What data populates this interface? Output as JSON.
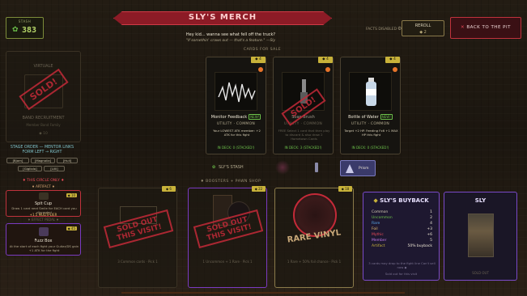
{
  "stash": {
    "label": "STASH",
    "icon": "cannabis-leaf-icon",
    "value": "383"
  },
  "header": {
    "title": "SLY'S MERCH",
    "line1": "Hey kid... wanna see what fell off the truck?",
    "line2": "\"If somethin' craws out — that's a feature.\" —Sly"
  },
  "facts": {
    "label": "FACTS DISABLED",
    "icon": "gear-icon"
  },
  "reroll": {
    "label": "REROLL",
    "cost": "◆ 2"
  },
  "back_button": {
    "label": "BACK TO THE PIT",
    "icon": "close-icon"
  },
  "left_card": {
    "title": "VIRTUALE",
    "name": "BAND RECRUITMENT",
    "sub": "Member Band Family",
    "num": "◆ 10",
    "stamp": "SOLD!"
  },
  "stage_order": {
    "line1": "STAGE ORDER — MENTOR LINKS",
    "line2": "FORM LEFT → RIGHT",
    "slots": [
      "[Bjorn]",
      "[Magnolia]",
      "[Hull]",
      "[Gigliolo]",
      "[Lilli]"
    ]
  },
  "circle": {
    "heading": "♦ THIS CIRCLE ONLY ♦",
    "subheading": "♦ ARTIFACT ♦",
    "cards": [
      {
        "name": "Spit Cup",
        "price": "◆ 10",
        "desc": "Draw 1 card next Smile for EACH card you discarded",
        "mult": "+1.5 MULTIPLIER"
      },
      {
        "name": "Fuzz Box",
        "price": "◆ 45",
        "desc": "At the start of each fight your Guitar/DS gain +1 ATK for the fight",
        "mult": ""
      }
    ],
    "effect_heading": "♦ EFFECT PEDAL ♦"
  },
  "cards_for_sale": {
    "heading": "CARDS FOR SALE",
    "cards": [
      {
        "name": "Monitor Feedback",
        "new": "NEW!",
        "type": "UTILITY · COMMON",
        "desc": "Your LOWEST ATK member: +2 ATK for this fight",
        "deck": "IN DECK: 0 (STACKED!)",
        "price": "◆ 4",
        "sold": false
      },
      {
        "name": "Soap Brush",
        "new": "",
        "type": "UTILITY · COMMON",
        "desc": "FREE Select 1 card that then play to discard & also draw 2 Hometown Cards",
        "deck": "IN DECK: 3 (STACKED!)",
        "price": "◆ 4",
        "sold": true,
        "stamp": "SOLD!"
      },
      {
        "name": "Bottle of Water",
        "new": "NEW!",
        "type": "UTILITY · COMMON",
        "desc": "Target +2 HP. Feeding Fx6 +1 MAX HP this fight",
        "deck": "IN DECK: 0 (STACKED!)",
        "price": "◆ 4",
        "sold": false
      }
    ]
  },
  "stash_row": {
    "label": "SLY'S STASH",
    "selected": "Prism"
  },
  "boosters": {
    "heading": "♦ BOOSTERS + PAWN SHOP",
    "items": [
      {
        "price": "◆ 6",
        "desc": "3 Common cards · Pick 1",
        "stamp": "SOLD OUT THIS VISIT!"
      },
      {
        "price": "◆ 22",
        "desc": "1 Uncommon + 1 Rare · Pick 1",
        "stamp": "SOLD OUT THIS VISIT!"
      },
      {
        "price": "◆ 18",
        "desc": "1 Rare + 50% foil chance · Pick 1",
        "stamp": "RARE VINYL"
      }
    ]
  },
  "buyback": {
    "title": "SLY'S BUYBACK",
    "rows": [
      {
        "k": "Common",
        "v": "1",
        "color": "#d8cfb6"
      },
      {
        "k": "Uncommon",
        "v": "2",
        "color": "#6cc04a"
      },
      {
        "k": "Rare",
        "v": "4",
        "color": "#5aa8e8"
      },
      {
        "k": "Foil",
        "v": "+3",
        "color": "#e8c070"
      },
      {
        "k": "Mythic",
        "v": "+6",
        "color": "#e84a58"
      },
      {
        "k": "Member",
        "v": "5",
        "color": "#c07ae8"
      },
      {
        "k": "Artifact",
        "v": "50% buyback",
        "color": "#c8b23a"
      }
    ],
    "footer": "3 cards may drop to the fight line Can't sell now ◆",
    "footer2": "Sold out for this visit"
  },
  "sly": {
    "title": "SLY",
    "sold": "SOLD OUT"
  }
}
